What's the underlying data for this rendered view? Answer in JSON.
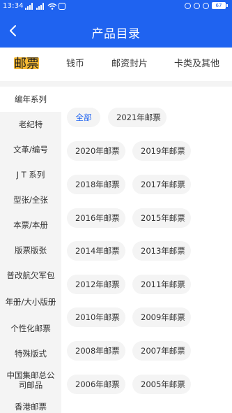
{
  "status_bar": {
    "time": "13:34",
    "signal1": "5G",
    "signal2": "4G",
    "battery": "67"
  },
  "app_bar": {
    "title": "产品目录"
  },
  "top_tabs": [
    {
      "label": "邮票",
      "active": true
    },
    {
      "label": "钱币",
      "active": false
    },
    {
      "label": "邮资封片",
      "active": false
    },
    {
      "label": "卡类及其他",
      "active": false
    }
  ],
  "sidebar": {
    "items": [
      {
        "label": "编年系列",
        "active": true
      },
      {
        "label": "老纪特",
        "active": false
      },
      {
        "label": "文革/编号",
        "active": false
      },
      {
        "label": "J T 系列",
        "active": false
      },
      {
        "label": "型张/全张",
        "active": false
      },
      {
        "label": "本票/本册",
        "active": false
      },
      {
        "label": "版票版张",
        "active": false
      },
      {
        "label": "普改航欠军包",
        "active": false
      },
      {
        "label": "年册/大小版册",
        "active": false
      },
      {
        "label": "个性化邮票",
        "active": false
      },
      {
        "label": "特殊版式",
        "active": false
      },
      {
        "label": "中国集邮总公司邮品",
        "active": false
      },
      {
        "label": "香港邮票",
        "active": false
      }
    ]
  },
  "filters": {
    "chips": [
      {
        "label": "全部",
        "active": true
      },
      {
        "label": "2021年邮票",
        "active": false
      },
      {
        "label": "2020年邮票",
        "active": false
      },
      {
        "label": "2019年邮票",
        "active": false
      },
      {
        "label": "2018年邮票",
        "active": false
      },
      {
        "label": "2017年邮票",
        "active": false
      },
      {
        "label": "2016年邮票",
        "active": false
      },
      {
        "label": "2015年邮票",
        "active": false
      },
      {
        "label": "2014年邮票",
        "active": false
      },
      {
        "label": "2013年邮票",
        "active": false
      },
      {
        "label": "2012年邮票",
        "active": false
      },
      {
        "label": "2011年邮票",
        "active": false
      },
      {
        "label": "2010年邮票",
        "active": false
      },
      {
        "label": "2009年邮票",
        "active": false
      },
      {
        "label": "2008年邮票",
        "active": false
      },
      {
        "label": "2007年邮票",
        "active": false
      },
      {
        "label": "2006年邮票",
        "active": false
      },
      {
        "label": "2005年邮票",
        "active": false
      }
    ]
  },
  "colors": {
    "primary": "#1f63f0",
    "highlight": "#f5b935",
    "panel": "#f4f4f4"
  }
}
